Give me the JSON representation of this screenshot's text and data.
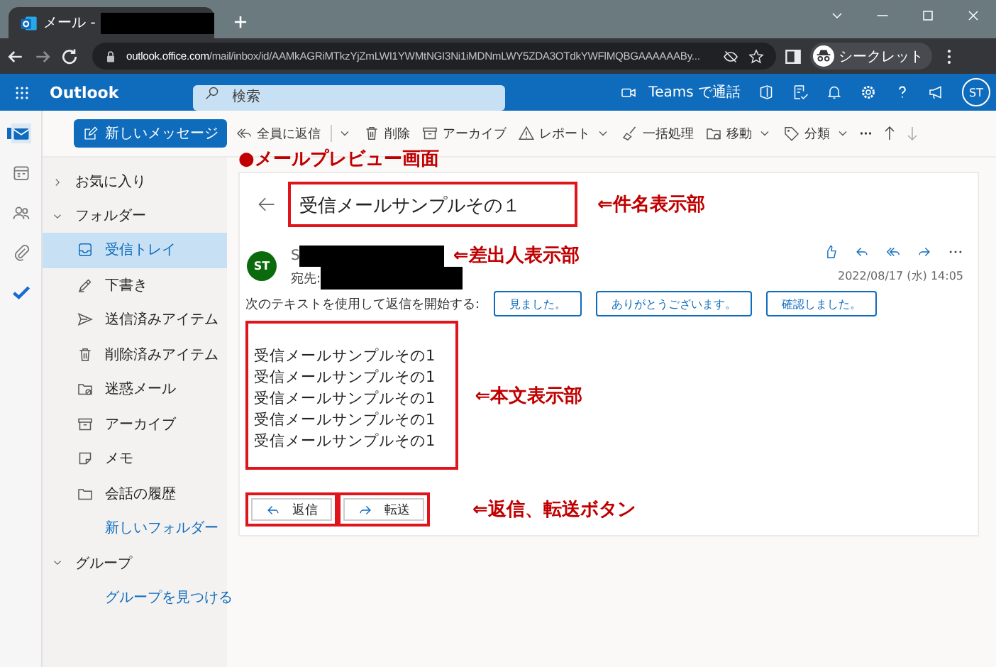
{
  "browser": {
    "tab_title": "メール - ",
    "url_host": "outlook.office.com",
    "url_path": "/mail/inbox/id/AAMkAGRiMTkzYjZmLWI1YWMtNGI3Ni1iMDNmLWY5ZDA3OTdkYWFlMQBGAAAAAABy...",
    "profile": "シークレット"
  },
  "app_bar": {
    "app_name": "Outlook",
    "search": {
      "placeholder": "検索"
    },
    "teams_call": "Teams で通話",
    "avatar": "ST"
  },
  "nav_rail": [
    {
      "selected": true
    },
    {
      "selected": false
    },
    {
      "selected": false
    },
    {
      "selected": false
    },
    {
      "selected": false
    }
  ],
  "toolbar": {
    "new_message": "新しいメッセージ",
    "actions": [
      {
        "label": "全員に返信",
        "dropdown": true
      },
      {
        "label": "削除",
        "dropdown": false
      },
      {
        "label": "アーカイブ",
        "dropdown": false
      },
      {
        "label": "レポート",
        "dropdown": true
      },
      {
        "label": "一括処理",
        "dropdown": false
      },
      {
        "label": "移動",
        "dropdown": true
      },
      {
        "label": "分類",
        "dropdown": true
      }
    ]
  },
  "sidebar": {
    "sections": [
      {
        "label": "お気に入り",
        "expanded": false
      },
      {
        "label": "フォルダー",
        "expanded": true,
        "children": [
          {
            "kind": "folder",
            "label": "受信トレイ",
            "selected": true
          },
          {
            "kind": "folder",
            "label": "下書き",
            "selected": false
          },
          {
            "kind": "folder",
            "label": "送信済みアイテム",
            "selected": false
          },
          {
            "kind": "folder",
            "label": "削除済みアイテム",
            "selected": false
          },
          {
            "kind": "folder",
            "label": "迷惑メール",
            "selected": false
          },
          {
            "kind": "folder",
            "label": "アーカイブ",
            "selected": false
          },
          {
            "kind": "folder",
            "label": "メモ",
            "selected": false
          },
          {
            "kind": "folder",
            "label": "会話の履歴",
            "selected": false
          },
          {
            "kind": "link",
            "label": "新しいフォルダー",
            "selected": false
          }
        ]
      },
      {
        "label": "グループ",
        "expanded": true,
        "children": [
          {
            "kind": "link",
            "label": "グループを見つける",
            "selected": false
          }
        ]
      }
    ]
  },
  "annotation_title": "●メールプレビュー画面",
  "message": {
    "subject": "受信メールサンプルその１",
    "sender_avatar": "ST",
    "sender": "S",
    "to_label": "宛先:",
    "date": "2022/08/17 (水) 14:05",
    "quick_reply_prompt": "次のテキストを使用して返信を開始する:",
    "quick_replies": [
      "見ました。",
      "ありがとうございます。",
      "確認しました。"
    ],
    "body": [
      "受信メールサンプルその1",
      "受信メールサンプルその1",
      "受信メールサンプルその1",
      "受信メールサンプルその1",
      "受信メールサンプルその1"
    ],
    "actions": [
      "返信",
      "転送"
    ]
  },
  "annotations": {
    "subject": "⇐件名表示部",
    "sender": "⇐差出人表示部",
    "body": "⇐本文表示部",
    "actions": "⇐返信、転送ボタン"
  }
}
